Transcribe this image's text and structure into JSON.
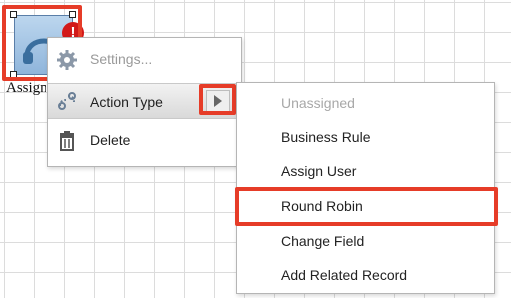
{
  "node": {
    "label": "Assign",
    "badge": "!",
    "icon": "headset-icon",
    "colors": {
      "node_fill": "#a9c8e8",
      "badge": "#d21919"
    }
  },
  "context_menu": {
    "items": [
      {
        "label": "Settings...",
        "icon": "gear-icon",
        "enabled": false
      },
      {
        "label": "Action Type",
        "icon": "link-icon",
        "has_submenu": true,
        "active": true
      },
      {
        "label": "Delete",
        "icon": "trash-icon",
        "enabled": true
      }
    ]
  },
  "submenu": {
    "items": [
      {
        "label": "Unassigned",
        "enabled": false
      },
      {
        "label": "Business Rule",
        "enabled": true
      },
      {
        "label": "Assign User",
        "enabled": true
      },
      {
        "label": "Round Robin",
        "enabled": true,
        "highlighted": true
      },
      {
        "label": "Change Field",
        "enabled": true
      },
      {
        "label": "Add Related Record",
        "enabled": true
      }
    ]
  },
  "highlight_color": "#e63c28"
}
